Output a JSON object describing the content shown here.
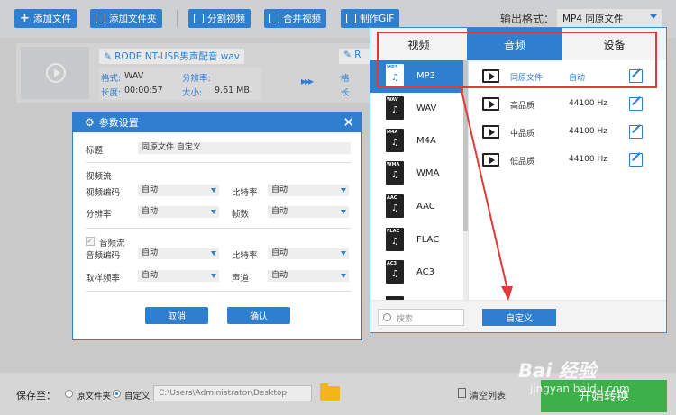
{
  "toolbar": {
    "add_file": "添加文件",
    "add_folder": "添加文件夹",
    "split_video": "分割视频",
    "merge_video": "合并视频",
    "make_gif": "制作GIF",
    "output_format_label": "输出格式：",
    "output_format_value": "MP4  同原文件"
  },
  "file": {
    "name": "RODE NT-USB男声配音.wav",
    "name_out": "R",
    "format_key": "格式:",
    "format_val": "WAV",
    "resolution_key": "分辨率:",
    "resolution_val": "",
    "length_key": "长度:",
    "length_val": "00:00:57",
    "size_key": "大小:",
    "size_val": "9.61 MB",
    "out_format_key": "格",
    "out_length_key": "长"
  },
  "dialog": {
    "title": "参数设置",
    "label_title": "标题",
    "title_value": "同原文件 自定义",
    "video_section": "视频流",
    "video_codec": "视频编码",
    "video_codec_val": "自动",
    "bitrate": "比特率",
    "bitrate_val": "自动",
    "resolution": "分辨率",
    "resolution_val": "自动",
    "framerate": "帧数",
    "framerate_val": "自动",
    "audio_section": "音频流",
    "audio_codec": "音频编码",
    "audio_codec_val": "自动",
    "audio_bitrate": "比特率",
    "audio_bitrate_val": "自动",
    "sample_rate": "取样频率",
    "sample_rate_val": "自动",
    "channel": "声道",
    "channel_val": "自动",
    "cancel": "取消",
    "confirm": "确认"
  },
  "format_panel": {
    "tabs": [
      "视频",
      "音频",
      "设备"
    ],
    "active_tab": 1,
    "formats": [
      {
        "label": "MP3",
        "tag": "MP3"
      },
      {
        "label": "WAV",
        "tag": "WAV"
      },
      {
        "label": "M4A",
        "tag": "M4A"
      },
      {
        "label": "WMA",
        "tag": "WMA"
      },
      {
        "label": "AAC",
        "tag": "AAC"
      },
      {
        "label": "FLAC",
        "tag": "FLAC"
      },
      {
        "label": "AC3",
        "tag": "AC3"
      }
    ],
    "qualities": [
      {
        "name": "同原文件",
        "value": "自动"
      },
      {
        "name": "高品质",
        "value": "44100 Hz"
      },
      {
        "name": "中品质",
        "value": "44100 Hz"
      },
      {
        "name": "低品质",
        "value": "44100 Hz"
      }
    ],
    "search_placeholder": "搜索",
    "custom": "自定义"
  },
  "bottom": {
    "save_to": "保存至：",
    "opt_source": "原文件夹",
    "opt_custom": "自定义",
    "path": "C:\\Users\\Administrator\\Desktop",
    "clear_list": "清空列表",
    "start": "开始转换"
  },
  "watermark": {
    "brand": "Bai 经验",
    "url": "jingyan.baidu.com"
  },
  "colors": {
    "accent": "#2e7fd0",
    "highlight_box": "#e23a3a",
    "start_button": "#3db049"
  }
}
